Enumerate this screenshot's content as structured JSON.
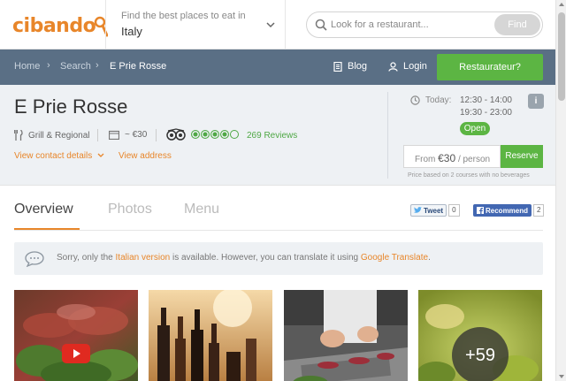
{
  "header": {
    "logo": "cibando",
    "location_label": "Find the best places to eat in",
    "location_value": "Italy",
    "search_placeholder": "Look for a restaurant...",
    "find_label": "Find"
  },
  "nav": {
    "breadcrumbs": [
      "Home",
      "Search",
      "E Prie Rosse"
    ],
    "blog_label": "Blog",
    "login_label": "Login",
    "restaurateur_label": "Restaurateur?"
  },
  "restaurant": {
    "name": "E Prie Rosse",
    "cuisine": "Grill & Regional",
    "price": "~ €30",
    "tripadvisor_rating": 4,
    "tripadvisor_max": 5,
    "reviews": "269 Reviews",
    "contact_link": "View contact details",
    "address_link": "View address",
    "hours_label": "Today:",
    "hours": [
      "12:30 - 14:00",
      "19:30 - 23:00"
    ],
    "status": "Open",
    "price_from": "From",
    "price_value": "€30",
    "price_unit": "/ person",
    "reserve_label": "Reserve",
    "price_note": "Price based on 2 courses with no beverages",
    "info_icon": "i"
  },
  "tabs": [
    {
      "label": "Overview",
      "active": true
    },
    {
      "label": "Photos",
      "active": false
    },
    {
      "label": "Menu",
      "active": false
    }
  ],
  "social": {
    "tweet_label": "Tweet",
    "tweet_count": "0",
    "recommend_label": "Recommend",
    "recommend_count": "2"
  },
  "notice": {
    "part1": "Sorry, only the ",
    "link1": "Italian version",
    "part2": " is available. However, you can translate it using ",
    "link2": "Google Translate",
    "part3": "."
  },
  "photos": {
    "more_count": "+59"
  },
  "colors": {
    "accent": "#e8862a",
    "green": "#5cb543",
    "nav": "#5a6f85"
  }
}
